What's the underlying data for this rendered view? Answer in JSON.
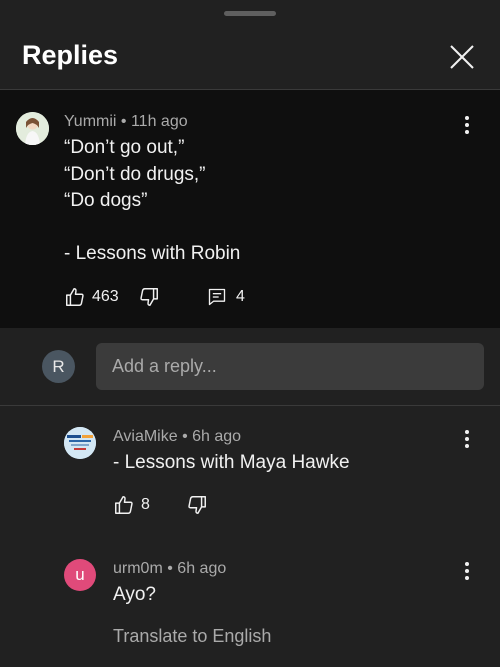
{
  "header": {
    "title": "Replies"
  },
  "top_comment": {
    "author": "Yummii",
    "time": "11h ago",
    "lines": [
      "“Don’t go out,”",
      "“Don’t do drugs,”",
      "“Do dogs”",
      "",
      "- Lessons with Robin"
    ],
    "likes": "463",
    "replies": "4"
  },
  "reply_box": {
    "user_initial": "R",
    "placeholder": "Add a reply..."
  },
  "replies": [
    {
      "author": "AviaMike",
      "time": "6h ago",
      "text": "- Lessons with Maya Hawke",
      "likes": "8"
    },
    {
      "author": "urm0m",
      "avatar_initial": "u",
      "avatar_color": "#e04a7a",
      "time": "6h ago",
      "text": "Ayo?",
      "translate_label": "Translate to English"
    }
  ],
  "separator": "•"
}
